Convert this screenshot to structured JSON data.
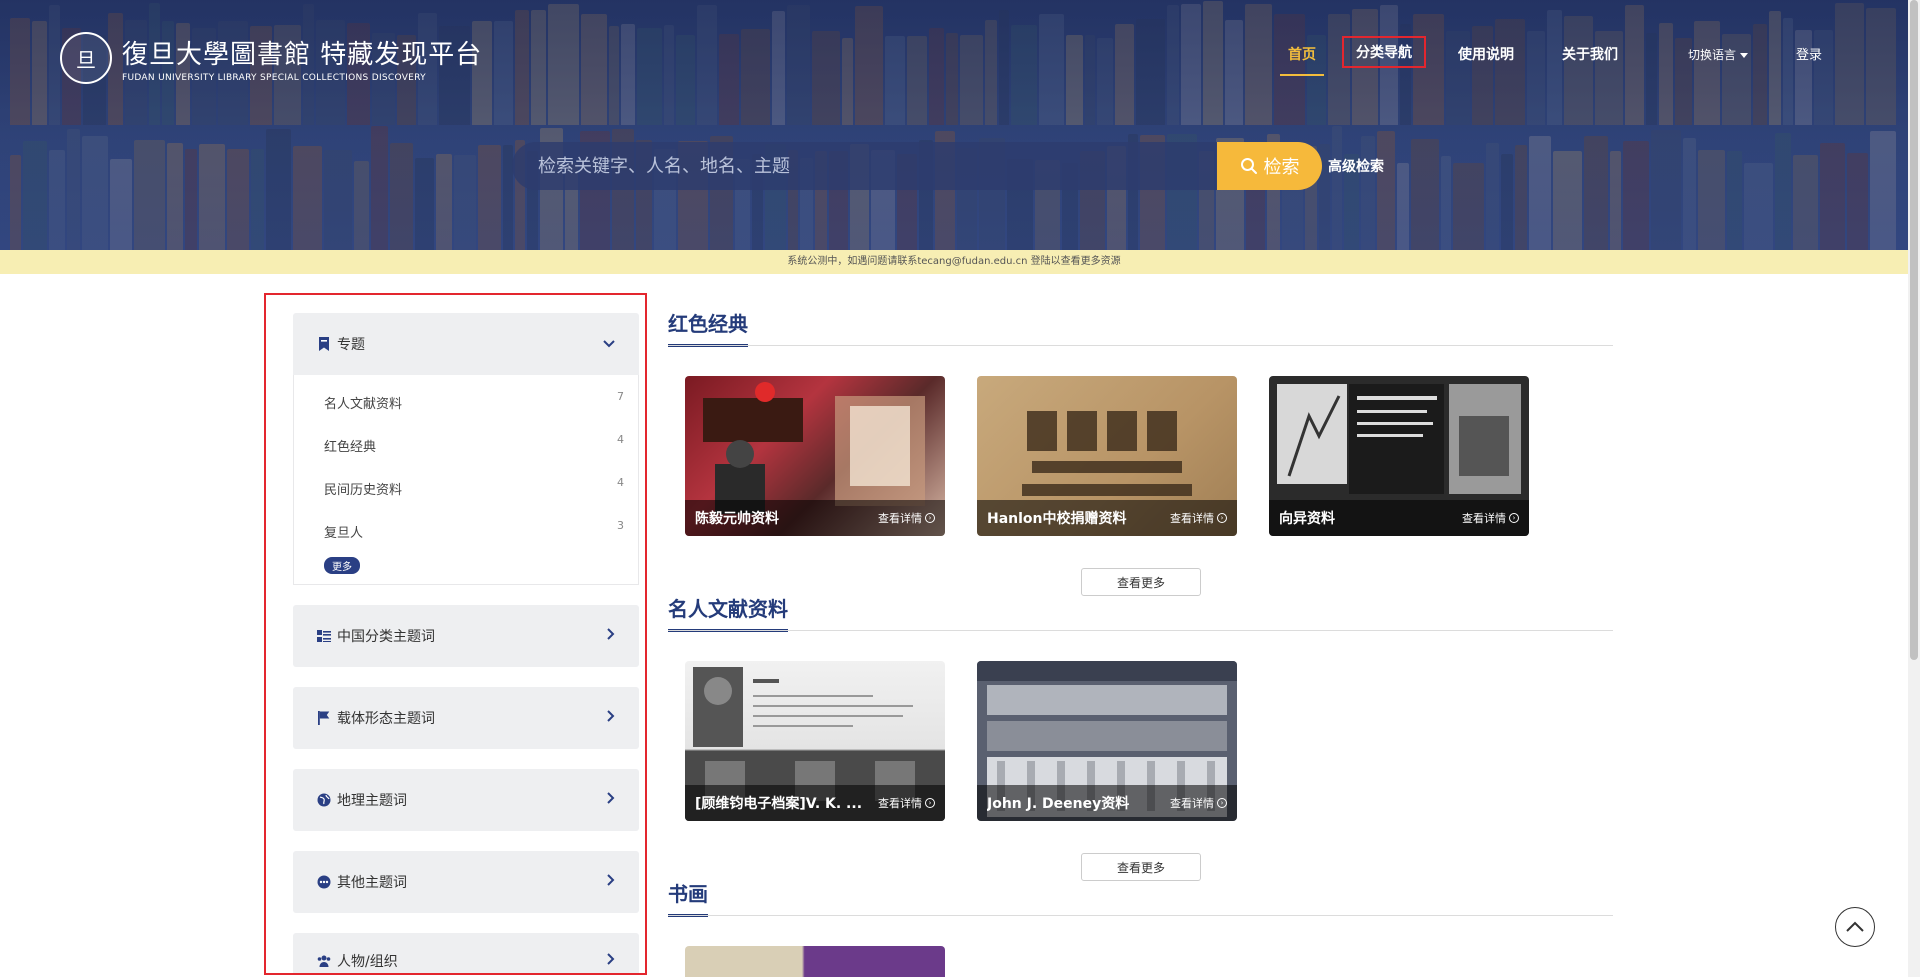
{
  "header": {
    "logo_seal": "旦",
    "logo_cn": "復旦大學圖書館 特藏发现平台",
    "logo_en": "FUDAN UNIVERSITY LIBRARY SPECIAL COLLECTIONS DISCOVERY",
    "nav": {
      "home": "首页",
      "categories": "分类导航",
      "guide": "使用说明",
      "about": "关于我们",
      "language": "切换语言",
      "login": "登录"
    }
  },
  "search": {
    "placeholder": "检索关键字、人名、地名、主题",
    "button_label": "检索",
    "advanced_label": "高级检索"
  },
  "notice": "系统公测中，如遇问题请联系tecang@fudan.edu.cn 登陆以查看更多资源",
  "sidebar": {
    "topic_panel": {
      "title": "专题",
      "items": [
        {
          "label": "名人文献资料",
          "count": "7"
        },
        {
          "label": "红色经典",
          "count": "4"
        },
        {
          "label": "民间历史资料",
          "count": "4"
        },
        {
          "label": "复旦人",
          "count": "3"
        }
      ],
      "more_label": "更多"
    },
    "panels": [
      {
        "title": "中国分类主题词",
        "icon": "list-icon"
      },
      {
        "title": "载体形态主题词",
        "icon": "flag-icon"
      },
      {
        "title": "地理主题词",
        "icon": "globe-icon"
      },
      {
        "title": "其他主题词",
        "icon": "ellipsis-icon"
      },
      {
        "title": "人物/组织",
        "icon": "people-icon"
      }
    ]
  },
  "sections": [
    {
      "title": "红色经典",
      "cards": [
        {
          "name": "陈毅元帅资料",
          "detail": "查看详情"
        },
        {
          "name": "Hanlon中校捐赠资料",
          "detail": "查看详情"
        },
        {
          "name": "向异资料",
          "detail": "查看详情"
        }
      ],
      "more_label": "查看更多"
    },
    {
      "title": "名人文献资料",
      "cards": [
        {
          "name": "[顾维钧电子档案]V. K. ...",
          "detail": "查看详情"
        },
        {
          "name": "John J. Deeney资料",
          "detail": "查看详情"
        }
      ],
      "more_label": "查看更多"
    },
    {
      "title": "书画",
      "cards": []
    }
  ],
  "colors": {
    "accent": "#f6b93b",
    "brand_navy": "#243b7a",
    "highlight_red": "#e3262e",
    "notice_bg": "#f7eeb3"
  }
}
